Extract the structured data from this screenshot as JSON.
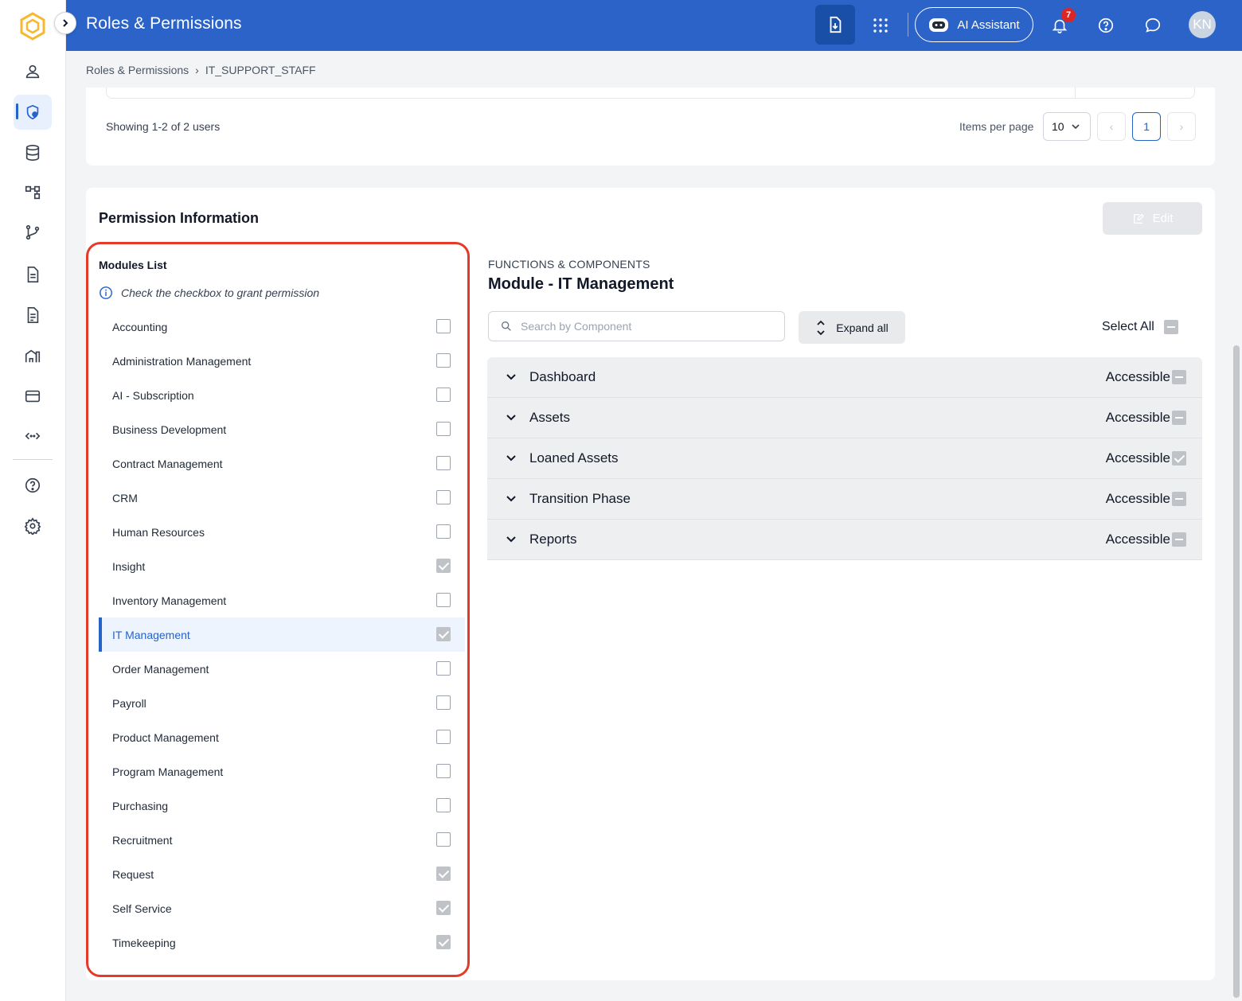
{
  "header": {
    "title": "Roles & Permissions",
    "ai_label": "AI Assistant",
    "notification_count": "7",
    "avatar_initials": "KN"
  },
  "breadcrumb": {
    "root": "Roles & Permissions",
    "separator": "›",
    "current": "IT_SUPPORT_STAFF"
  },
  "users": {
    "showing": "Showing 1-2 of 2 users",
    "items_per_page_label": "Items per page",
    "items_per_page": "10",
    "prev": "‹",
    "current_page": "1",
    "next": "›"
  },
  "permissions": {
    "title": "Permission Information",
    "edit_label": "Edit",
    "modules_title": "Modules List",
    "modules_hint": "Check the checkbox to grant permission",
    "modules": [
      {
        "label": "Accounting",
        "checked": false
      },
      {
        "label": "Administration Management",
        "checked": false
      },
      {
        "label": "AI - Subscription",
        "checked": false
      },
      {
        "label": "Business Development",
        "checked": false
      },
      {
        "label": "Contract Management",
        "checked": false
      },
      {
        "label": "CRM",
        "checked": false
      },
      {
        "label": "Human Resources",
        "checked": false
      },
      {
        "label": "Insight",
        "checked": true
      },
      {
        "label": "Inventory Management",
        "checked": false
      },
      {
        "label": "IT Management",
        "checked": true,
        "active": true
      },
      {
        "label": "Order Management",
        "checked": false
      },
      {
        "label": "Payroll",
        "checked": false
      },
      {
        "label": "Product Management",
        "checked": false
      },
      {
        "label": "Program Management",
        "checked": false
      },
      {
        "label": "Purchasing",
        "checked": false
      },
      {
        "label": "Recruitment",
        "checked": false
      },
      {
        "label": "Request",
        "checked": true
      },
      {
        "label": "Self Service",
        "checked": true
      },
      {
        "label": "Timekeeping",
        "checked": true
      }
    ],
    "functions_label": "FUNCTIONS & COMPONENTS",
    "module_title": "Module - IT Management",
    "search_placeholder": "Search by Component",
    "expand_all_label": "Expand all",
    "select_all_label": "Select All",
    "components": [
      {
        "name": "Dashboard",
        "status": "Accessible",
        "state": "partial"
      },
      {
        "name": "Assets",
        "status": "Accessible",
        "state": "partial"
      },
      {
        "name": "Loaned Assets",
        "status": "Accessible",
        "state": "checked"
      },
      {
        "name": "Transition Phase",
        "status": "Accessible",
        "state": "partial"
      },
      {
        "name": "Reports",
        "status": "Accessible",
        "state": "partial"
      }
    ]
  },
  "colors": {
    "header_bg": "#2b63c9",
    "accent": "#2563c9",
    "highlight_border": "#e53a2a"
  }
}
